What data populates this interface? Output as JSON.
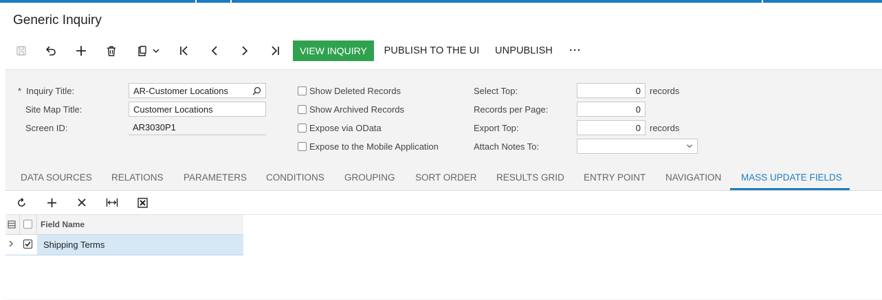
{
  "window": {
    "title": "Generic Inquiry"
  },
  "toolbar": {
    "view_inquiry": "VIEW INQUIRY",
    "publish": "PUBLISH TO THE UI",
    "unpublish": "UNPUBLISH",
    "more": "···"
  },
  "form": {
    "required_mark": "*",
    "inquiry_title_label": "Inquiry Title:",
    "inquiry_title_value": "AR-Customer Locations",
    "site_map_title_label": "Site Map Title:",
    "site_map_title_value": "Customer Locations",
    "screen_id_label": "Screen ID:",
    "screen_id_value": "AR3030P1",
    "show_deleted": "Show Deleted Records",
    "show_archived": "Show Archived Records",
    "expose_odata": "Expose via OData",
    "expose_mobile": "Expose to the Mobile Application",
    "select_top_label": "Select Top:",
    "select_top_value": "0",
    "select_top_unit": "records",
    "records_per_page_label": "Records per Page:",
    "records_per_page_value": "0",
    "export_top_label": "Export Top:",
    "export_top_value": "0",
    "export_top_unit": "records",
    "attach_notes_label": "Attach Notes To:",
    "attach_notes_value": ""
  },
  "tabs": [
    {
      "label": "DATA SOURCES"
    },
    {
      "label": "RELATIONS"
    },
    {
      "label": "PARAMETERS"
    },
    {
      "label": "CONDITIONS"
    },
    {
      "label": "GROUPING"
    },
    {
      "label": "SORT ORDER"
    },
    {
      "label": "RESULTS GRID"
    },
    {
      "label": "ENTRY POINT"
    },
    {
      "label": "NAVIGATION"
    },
    {
      "label": "MASS UPDATE FIELDS"
    }
  ],
  "active_tab": "MASS UPDATE FIELDS",
  "grid": {
    "column_field_name": "Field Name",
    "rows": [
      {
        "field_name": "Shipping Terms",
        "selected": true
      }
    ]
  },
  "colors": {
    "accent": "#1b7dc1",
    "view_button": "#30a14e",
    "row_highlight": "#d6e7f5"
  }
}
